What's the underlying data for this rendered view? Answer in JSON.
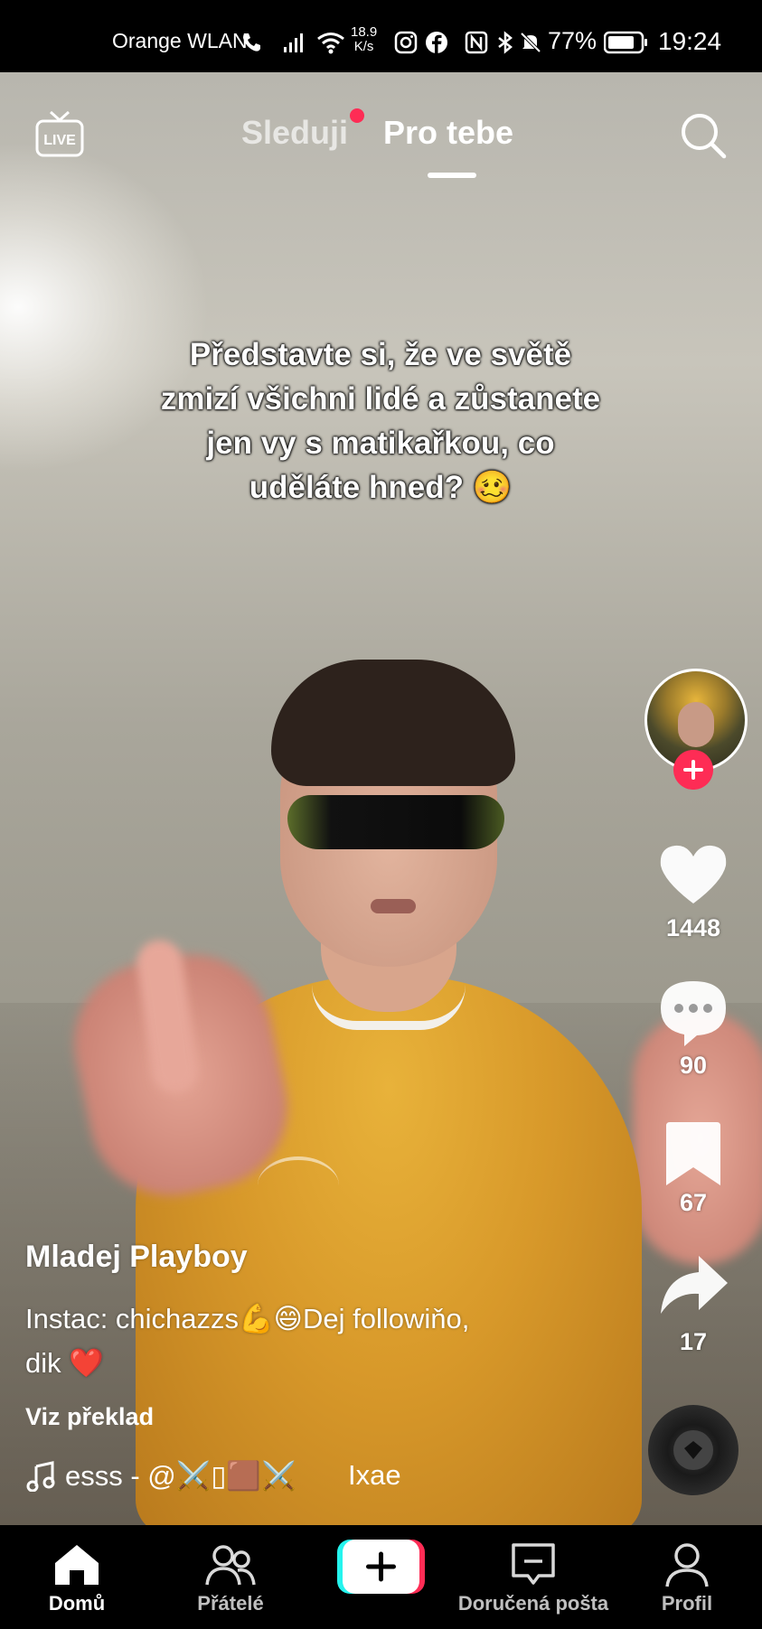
{
  "status_bar": {
    "carrier": "Orange WLAN",
    "speed_value": "18.9",
    "speed_unit": "K/s",
    "battery_percent": "77%",
    "time": "19:24"
  },
  "top_nav": {
    "live_label": "LIVE",
    "tabs": [
      {
        "label": "Sleduji",
        "active": false,
        "has_notification_dot": true
      },
      {
        "label": "Pro tebe",
        "active": true
      }
    ]
  },
  "video": {
    "overlay_text": [
      "Představte si, že ve světě",
      "zmizí všichni lidé a zůstanete",
      "jen vy s matikařkou, co",
      "uděláte hned? 🥴"
    ],
    "author": "Mladej Playboy",
    "description_lines": [
      "Instac: chichazzs💪😄Dej followiňo,",
      "dik ❤️"
    ],
    "translate_label": "Viz překlad",
    "music_text": "esss - @⚔️▯🟫⚔️",
    "music_artist": "Ixae"
  },
  "rail": {
    "likes": "1448",
    "comments": "90",
    "saves": "67",
    "shares": "17"
  },
  "bottom_nav": [
    {
      "label": "Domů",
      "icon": "home-icon",
      "active": true
    },
    {
      "label": "Přátelé",
      "icon": "friends-icon",
      "active": false
    },
    {
      "label": "",
      "icon": "create-icon",
      "active": false
    },
    {
      "label": "Doručená pošta",
      "icon": "inbox-icon",
      "active": false
    },
    {
      "label": "Profil",
      "icon": "profile-icon",
      "active": false
    }
  ],
  "colors": {
    "accent_red": "#fe2c55",
    "accent_cyan": "#25f4ee",
    "shirt_yellow": "#e0a532"
  }
}
